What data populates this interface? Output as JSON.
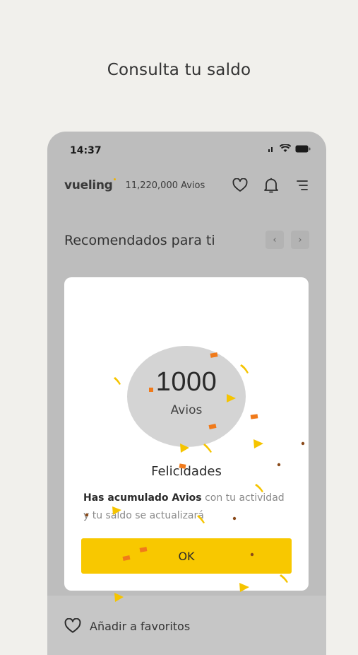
{
  "headline": "Consulta tu saldo",
  "status_bar": {
    "time": "14:37"
  },
  "app_bar": {
    "brand": "vueling",
    "avios_balance": "11,220,000 Avios",
    "icons": [
      "heart-icon",
      "bell-icon",
      "menu-icon"
    ]
  },
  "section": {
    "title": "Recomendados para ti",
    "prev": "‹",
    "next": "›"
  },
  "modal": {
    "points_value": "1000",
    "points_unit": "Avios",
    "title": "Felicidades",
    "message_bold": "Has acumulado Avios",
    "message_rest": " con tu actividad y tu saldo se actualizará",
    "ok_label": "OK"
  },
  "bottom": {
    "favorites_label": "Añadir a favoritos"
  },
  "colors": {
    "accent": "#f8c800",
    "confetti_orange": "#f07a1a",
    "confetti_yellow": "#f5c400"
  }
}
